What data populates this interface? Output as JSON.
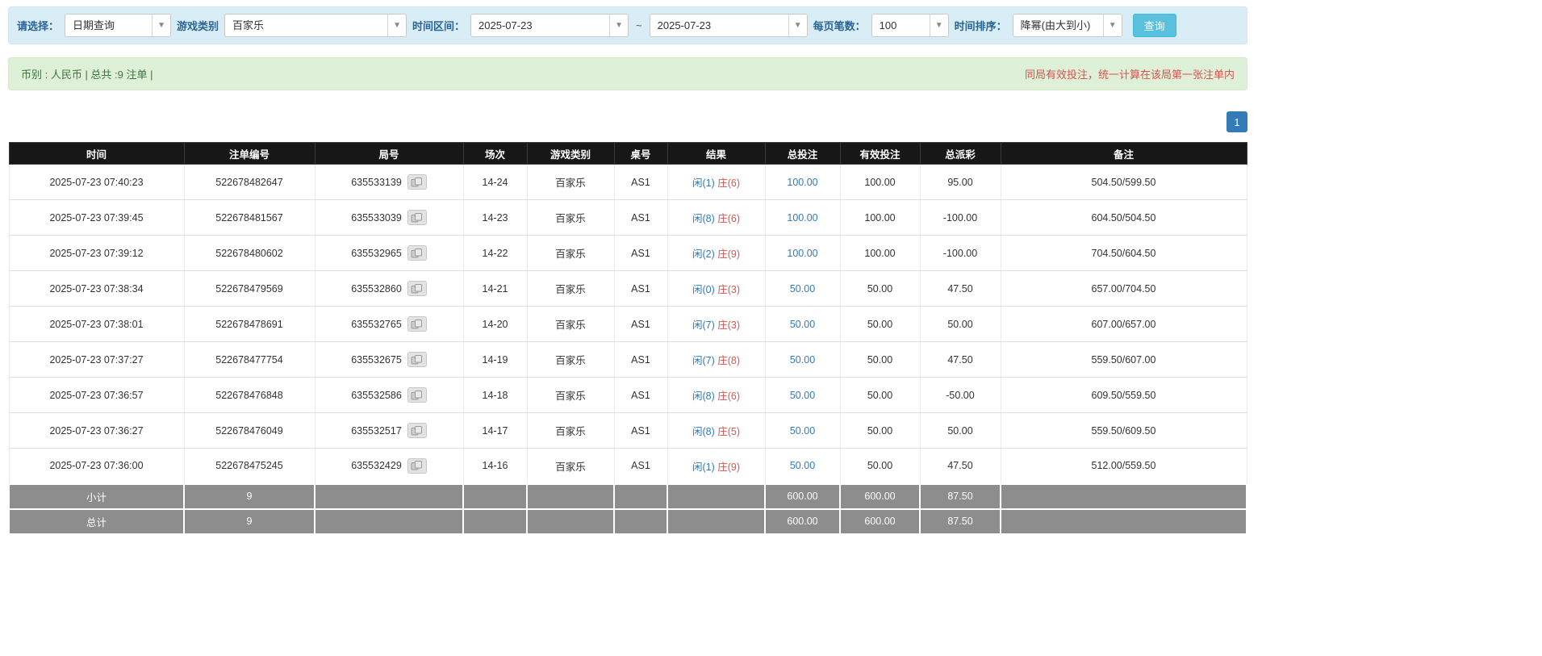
{
  "filters": {
    "select_label": "请选择：",
    "select_value": "日期查询",
    "game_label": "游戏类别",
    "game_value": "百家乐",
    "time_label": "时间区间：",
    "date_from": "2025-07-23",
    "tilde": "~",
    "date_to": "2025-07-23",
    "per_page_label": "每页笔数：",
    "per_page_value": "100",
    "sort_label": "时间排序：",
    "sort_value": "降幂(由大到小)",
    "query_button": "查询"
  },
  "summary": {
    "left": "币别 : 人民币 | 总共 :9 注单 |",
    "right": "同局有效投注，统一计算在该局第一张注单内"
  },
  "pagination": {
    "current_page": "1"
  },
  "table": {
    "headers": [
      "时间",
      "注单编号",
      "局号",
      "场次",
      "游戏类别",
      "桌号",
      "结果",
      "总投注",
      "有效投注",
      "总派彩",
      "备注"
    ],
    "rows": [
      {
        "time": "2025-07-23 07:40:23",
        "bet_id": "522678482647",
        "round": "635533139",
        "session": "14-24",
        "game": "百家乐",
        "table_no": "AS1",
        "player": "闲(1)",
        "banker": "庄(6)",
        "total_bet": "100.00",
        "valid_bet": "100.00",
        "payout": "95.00",
        "remark": "504.50/599.50"
      },
      {
        "time": "2025-07-23 07:39:45",
        "bet_id": "522678481567",
        "round": "635533039",
        "session": "14-23",
        "game": "百家乐",
        "table_no": "AS1",
        "player": "闲(8)",
        "banker": "庄(6)",
        "total_bet": "100.00",
        "valid_bet": "100.00",
        "payout": "-100.00",
        "remark": "604.50/504.50"
      },
      {
        "time": "2025-07-23 07:39:12",
        "bet_id": "522678480602",
        "round": "635532965",
        "session": "14-22",
        "game": "百家乐",
        "table_no": "AS1",
        "player": "闲(2)",
        "banker": "庄(9)",
        "total_bet": "100.00",
        "valid_bet": "100.00",
        "payout": "-100.00",
        "remark": "704.50/604.50"
      },
      {
        "time": "2025-07-23 07:38:34",
        "bet_id": "522678479569",
        "round": "635532860",
        "session": "14-21",
        "game": "百家乐",
        "table_no": "AS1",
        "player": "闲(0)",
        "banker": "庄(3)",
        "total_bet": "50.00",
        "valid_bet": "50.00",
        "payout": "47.50",
        "remark": "657.00/704.50"
      },
      {
        "time": "2025-07-23 07:38:01",
        "bet_id": "522678478691",
        "round": "635532765",
        "session": "14-20",
        "game": "百家乐",
        "table_no": "AS1",
        "player": "闲(7)",
        "banker": "庄(3)",
        "total_bet": "50.00",
        "valid_bet": "50.00",
        "payout": "50.00",
        "remark": "607.00/657.00"
      },
      {
        "time": "2025-07-23 07:37:27",
        "bet_id": "522678477754",
        "round": "635532675",
        "session": "14-19",
        "game": "百家乐",
        "table_no": "AS1",
        "player": "闲(7)",
        "banker": "庄(8)",
        "total_bet": "50.00",
        "valid_bet": "50.00",
        "payout": "47.50",
        "remark": "559.50/607.00"
      },
      {
        "time": "2025-07-23 07:36:57",
        "bet_id": "522678476848",
        "round": "635532586",
        "session": "14-18",
        "game": "百家乐",
        "table_no": "AS1",
        "player": "闲(8)",
        "banker": "庄(6)",
        "total_bet": "50.00",
        "valid_bet": "50.00",
        "payout": "-50.00",
        "remark": "609.50/559.50"
      },
      {
        "time": "2025-07-23 07:36:27",
        "bet_id": "522678476049",
        "round": "635532517",
        "session": "14-17",
        "game": "百家乐",
        "table_no": "AS1",
        "player": "闲(8)",
        "banker": "庄(5)",
        "total_bet": "50.00",
        "valid_bet": "50.00",
        "payout": "50.00",
        "remark": "559.50/609.50"
      },
      {
        "time": "2025-07-23 07:36:00",
        "bet_id": "522678475245",
        "round": "635532429",
        "session": "14-16",
        "game": "百家乐",
        "table_no": "AS1",
        "player": "闲(1)",
        "banker": "庄(9)",
        "total_bet": "50.00",
        "valid_bet": "50.00",
        "payout": "47.50",
        "remark": "512.00/559.50"
      }
    ],
    "subtotal": {
      "label": "小计",
      "count": "9",
      "total_bet": "600.00",
      "valid_bet": "600.00",
      "payout": "87.50"
    },
    "total": {
      "label": "总计",
      "count": "9",
      "total_bet": "600.00",
      "valid_bet": "600.00",
      "payout": "87.50"
    }
  }
}
